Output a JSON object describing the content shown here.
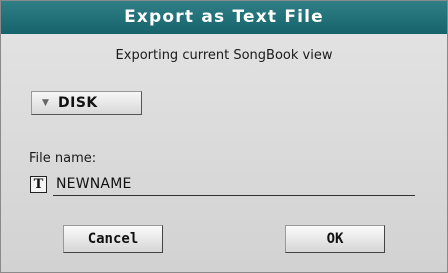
{
  "dialog": {
    "title": "Export as Text File",
    "subtitle": "Exporting current SongBook view"
  },
  "destination": {
    "selected": "DISK",
    "icon": "triangle-down"
  },
  "file_name": {
    "label": "File name:",
    "value": "NEWNAME",
    "edit_icon": "T"
  },
  "buttons": {
    "cancel": "Cancel",
    "ok": "OK"
  },
  "colors": {
    "titlebar": "#1f6f77",
    "background": "#d9d9d9"
  }
}
